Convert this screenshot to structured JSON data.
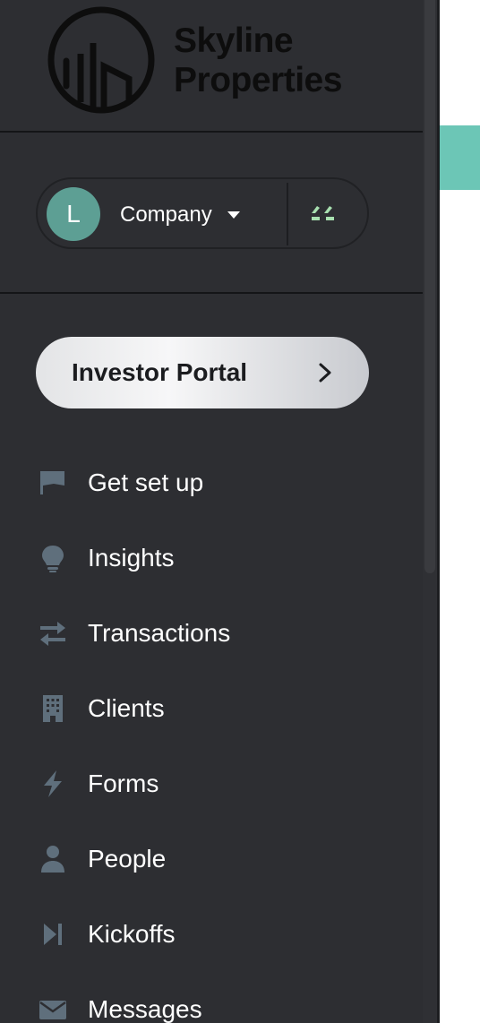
{
  "brand": {
    "name_line1": "Skyline",
    "name_line2": "Properties",
    "logo_icon": "skyline-building-logo"
  },
  "company_switcher": {
    "avatar_initial": "L",
    "label": "Company",
    "caret_icon": "caret-down-icon",
    "brand_icon": "app-brand-icon"
  },
  "portal_button": {
    "label": "Investor Portal",
    "icon": "chevron-right-icon"
  },
  "nav": {
    "items": [
      {
        "label": "Get set up",
        "icon": "flag-icon"
      },
      {
        "label": "Insights",
        "icon": "lightbulb-icon"
      },
      {
        "label": "Transactions",
        "icon": "swap-arrows-icon"
      },
      {
        "label": "Clients",
        "icon": "building-icon"
      },
      {
        "label": "Forms",
        "icon": "lightning-bolt-icon"
      },
      {
        "label": "People",
        "icon": "person-icon"
      },
      {
        "label": "Kickoffs",
        "icon": "skip-next-icon"
      },
      {
        "label": "Messages",
        "icon": "envelope-icon"
      }
    ]
  },
  "colors": {
    "sidebar_bg": "#2d2e32",
    "avatar_bg": "#5d9f94",
    "accent_teal": "#6cc6b6",
    "brand_green": "#a8e0b0",
    "nav_icon": "#5f6f7c"
  }
}
